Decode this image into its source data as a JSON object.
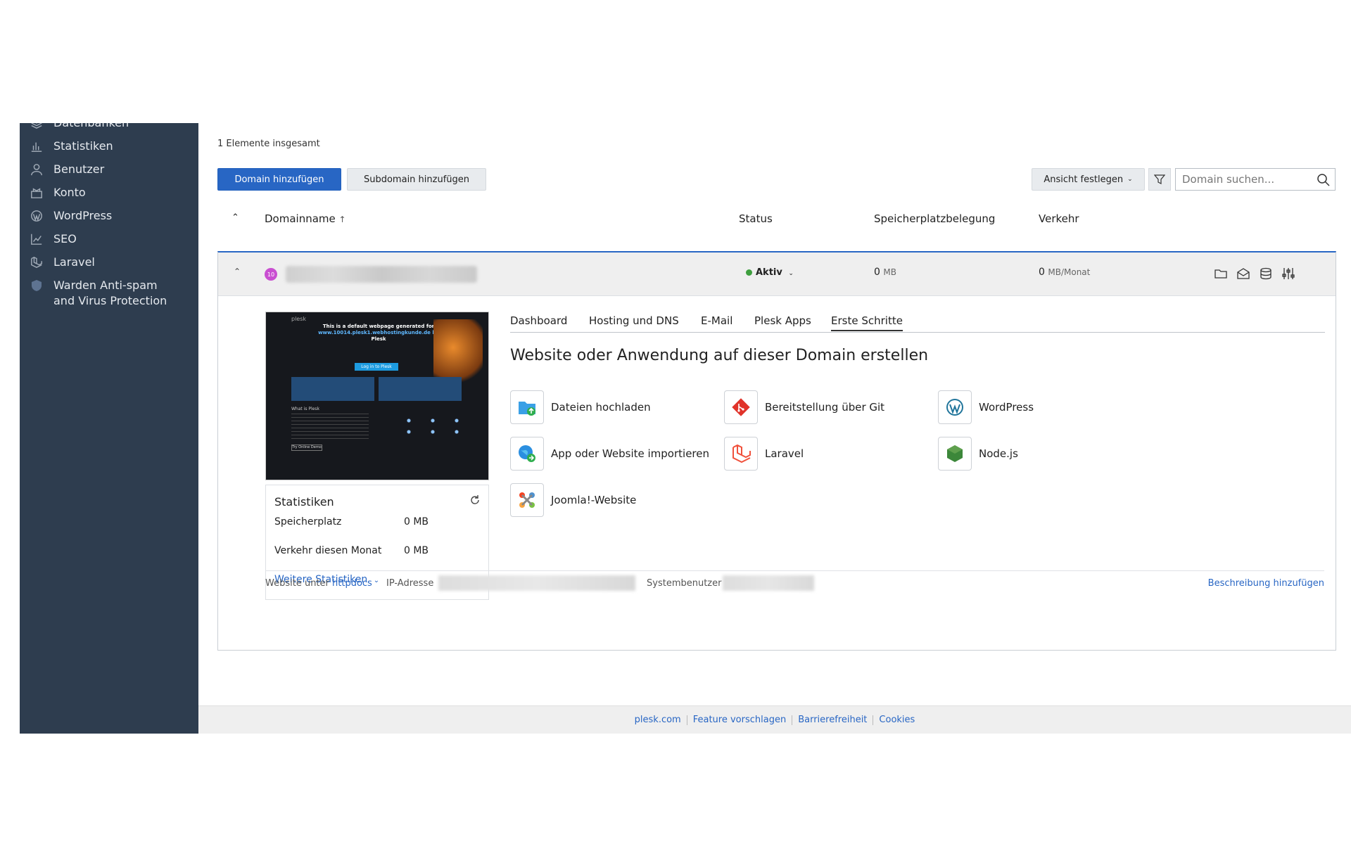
{
  "sidebar": {
    "items": [
      {
        "label": "Datenbanken",
        "icon": "database-icon"
      },
      {
        "label": "Statistiken",
        "icon": "bar-chart-icon"
      },
      {
        "label": "Benutzer",
        "icon": "user-icon"
      },
      {
        "label": "Konto",
        "icon": "account-icon"
      },
      {
        "label": "WordPress",
        "icon": "wordpress-icon"
      },
      {
        "label": "SEO",
        "icon": "seo-chart-icon"
      },
      {
        "label": "Laravel",
        "icon": "laravel-icon"
      },
      {
        "label": "Warden Anti-spam and Virus Protection",
        "icon": "shield-icon"
      }
    ]
  },
  "main": {
    "total": "1 Elemente insgesamt",
    "add_domain": "Domain hinzufügen",
    "add_subdomain": "Subdomain hinzufügen",
    "view_set": "Ansicht festlegen",
    "search_placeholder": "Domain suchen...",
    "columns": {
      "domain": "Domainname",
      "domain_sort": "↑",
      "status": "Status",
      "storage": "Speicherplatzbelegung",
      "traffic": "Verkehr"
    }
  },
  "row": {
    "avatar": "10",
    "status": "Aktiv",
    "storage_value": "0",
    "storage_unit": "MB",
    "traffic_value": "0",
    "traffic_unit": "MB/Monat"
  },
  "preview": {
    "brand": "plesk",
    "headline_1": "This is a default webpage generated for",
    "headline_2": "www.10014.plesk1.webhostingkunde.de by",
    "headline_3": "Plesk",
    "button": "Log in to Plesk",
    "section": "What is Plesk",
    "demo": "Try Online Demo"
  },
  "stats": {
    "title": "Statistiken",
    "storage_label": "Speicherplatz",
    "storage_value": "0 MB",
    "traffic_label": "Verkehr diesen Monat",
    "traffic_value": "0 MB",
    "more": "Weitere Statistiken"
  },
  "tabs": [
    "Dashboard",
    "Hosting und DNS",
    "E-Mail",
    "Plesk Apps",
    "Erste Schritte"
  ],
  "section_title": "Website oder Anwendung auf dieser Domain erstellen",
  "tiles": [
    {
      "label": "Dateien hochladen",
      "icon": "upload-folder-icon"
    },
    {
      "label": "Bereitstellung über Git",
      "icon": "git-icon"
    },
    {
      "label": "WordPress",
      "icon": "wordpress-icon"
    },
    {
      "label": "App oder Website importieren",
      "icon": "import-globe-icon"
    },
    {
      "label": "Laravel",
      "icon": "laravel-icon"
    },
    {
      "label": "Node.js",
      "icon": "nodejs-icon"
    },
    {
      "label": "Joomla!-Website",
      "icon": "joomla-icon"
    }
  ],
  "info": {
    "website_prefix": "Website unter",
    "website_link": "httpdocs",
    "ip_label": "IP-Adresse",
    "sysuser_label": "Systembenutzer",
    "add_description": "Beschreibung hinzufügen"
  },
  "footer": {
    "links": [
      "plesk.com",
      "Feature vorschlagen",
      "Barrierefreiheit",
      "Cookies"
    ]
  },
  "colors": {
    "sidebar": "#2e3d4f",
    "primary": "#2866c4",
    "active_status": "#3e9f3e"
  }
}
